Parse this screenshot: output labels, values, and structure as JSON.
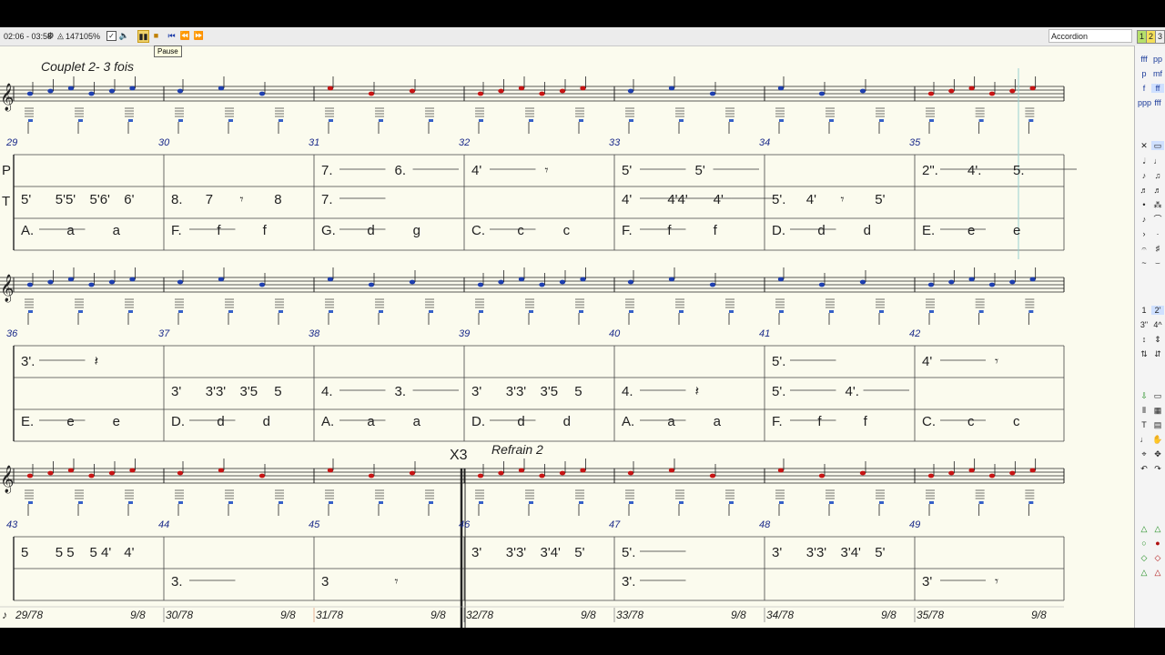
{
  "toolbar": {
    "time": "02:06 - 03:58",
    "tempo": "147",
    "zoom": "105%",
    "instrument": "Accordion",
    "voices": [
      "1",
      "2",
      "3"
    ],
    "tooltip": "Pause"
  },
  "score": {
    "titles": {
      "couplet": "Couplet 2- 3 fois",
      "repeat": "X3",
      "refrain": "Refrain 2"
    },
    "row_labels": {
      "p": "P",
      "t": "T"
    },
    "measure_numbers": [
      "29",
      "30",
      "31",
      "32",
      "33",
      "34",
      "35",
      "36",
      "37",
      "38",
      "39",
      "40",
      "41",
      "42",
      "43",
      "44",
      "45",
      "46",
      "47",
      "48",
      "49"
    ],
    "rows": [
      {
        "tab1": [
          [
            "5'",
            "5'5'",
            "5'6'",
            "6'"
          ],
          [
            "8.",
            "7",
            "𝄾",
            "8"
          ],
          [
            "7."
          ],
          [],
          [
            "4'",
            "4'4'",
            "4'"
          ],
          [
            "5'.",
            "4'",
            "𝄾",
            "5'"
          ],
          []
        ],
        "tab2": [
          [
            "A.",
            "a",
            "a"
          ],
          [
            "F.",
            "f",
            "f"
          ],
          [
            "G.",
            "d",
            "g"
          ],
          [
            "C.",
            "c",
            "c"
          ],
          [
            "F.",
            "f",
            "f"
          ],
          [
            "D.",
            "d",
            "d"
          ],
          [
            "E.",
            "e",
            "e"
          ]
        ],
        "push": [
          [],
          [],
          [
            "7.",
            "6."
          ],
          [
            "4'",
            "𝄾"
          ],
          [
            "5'",
            "5'"
          ],
          [],
          [
            "2\".",
            "4'.",
            "5."
          ]
        ]
      },
      {
        "push": [
          [
            "3'.",
            "𝄽"
          ],
          [],
          [],
          [],
          [],
          [
            "5'."
          ],
          [
            "4'",
            "𝄾"
          ]
        ],
        "tab1": [
          [],
          [
            "3'",
            "3'3'",
            "3'5",
            "5"
          ],
          [
            "4.",
            "3."
          ],
          [
            "3'",
            "3'3'",
            "3'5",
            "5"
          ],
          [
            "4.",
            "𝄽"
          ],
          [
            "5'.",
            "4'."
          ],
          []
        ],
        "tab2": [
          [
            "E.",
            "e",
            "e"
          ],
          [
            "D.",
            "d",
            "d"
          ],
          [
            "A.",
            "a",
            "a"
          ],
          [
            "D.",
            "d",
            "d"
          ],
          [
            "A.",
            "a",
            "a"
          ],
          [
            "F.",
            "f",
            "f"
          ],
          [
            "C.",
            "c",
            "c"
          ]
        ]
      },
      {
        "push": [
          [
            "5",
            "5 5",
            "5 4'",
            "4'"
          ],
          [],
          [],
          [
            "3'",
            "3'3'",
            "3'4'",
            "5'"
          ],
          [
            "5'."
          ],
          [
            "3'",
            "3'3'",
            "3'4'",
            "5'"
          ],
          []
        ],
        "tab1": [
          [],
          [
            "3."
          ],
          [
            "3",
            "𝄾"
          ],
          [],
          [
            "3'."
          ],
          [],
          [
            "3'",
            "𝄾"
          ]
        ]
      }
    ],
    "timeline": [
      {
        "pos": "29/78",
        "sig": "9/8"
      },
      {
        "pos": "30/78",
        "sig": "9/8"
      },
      {
        "pos": "31/78",
        "sig": "9/8"
      },
      {
        "pos": "32/78",
        "sig": "9/8"
      },
      {
        "pos": "33/78",
        "sig": "9/8"
      },
      {
        "pos": "34/78",
        "sig": "9/8"
      },
      {
        "pos": "35/78",
        "sig": "9/8"
      }
    ]
  },
  "palette": {
    "dynamics": [
      "fff",
      "pp",
      "p",
      "mf",
      "f",
      "ff",
      "ppp",
      "fff"
    ],
    "numbers": [
      "1",
      "2'",
      "3\"",
      "4^"
    ]
  },
  "colors": {
    "background": "#fbfbee",
    "staff": "#222222",
    "measure_number": "#1a2a8a",
    "note_blue": "#1e3fb0",
    "note_red": "#c81414",
    "bass_blue": "#3560c8"
  }
}
